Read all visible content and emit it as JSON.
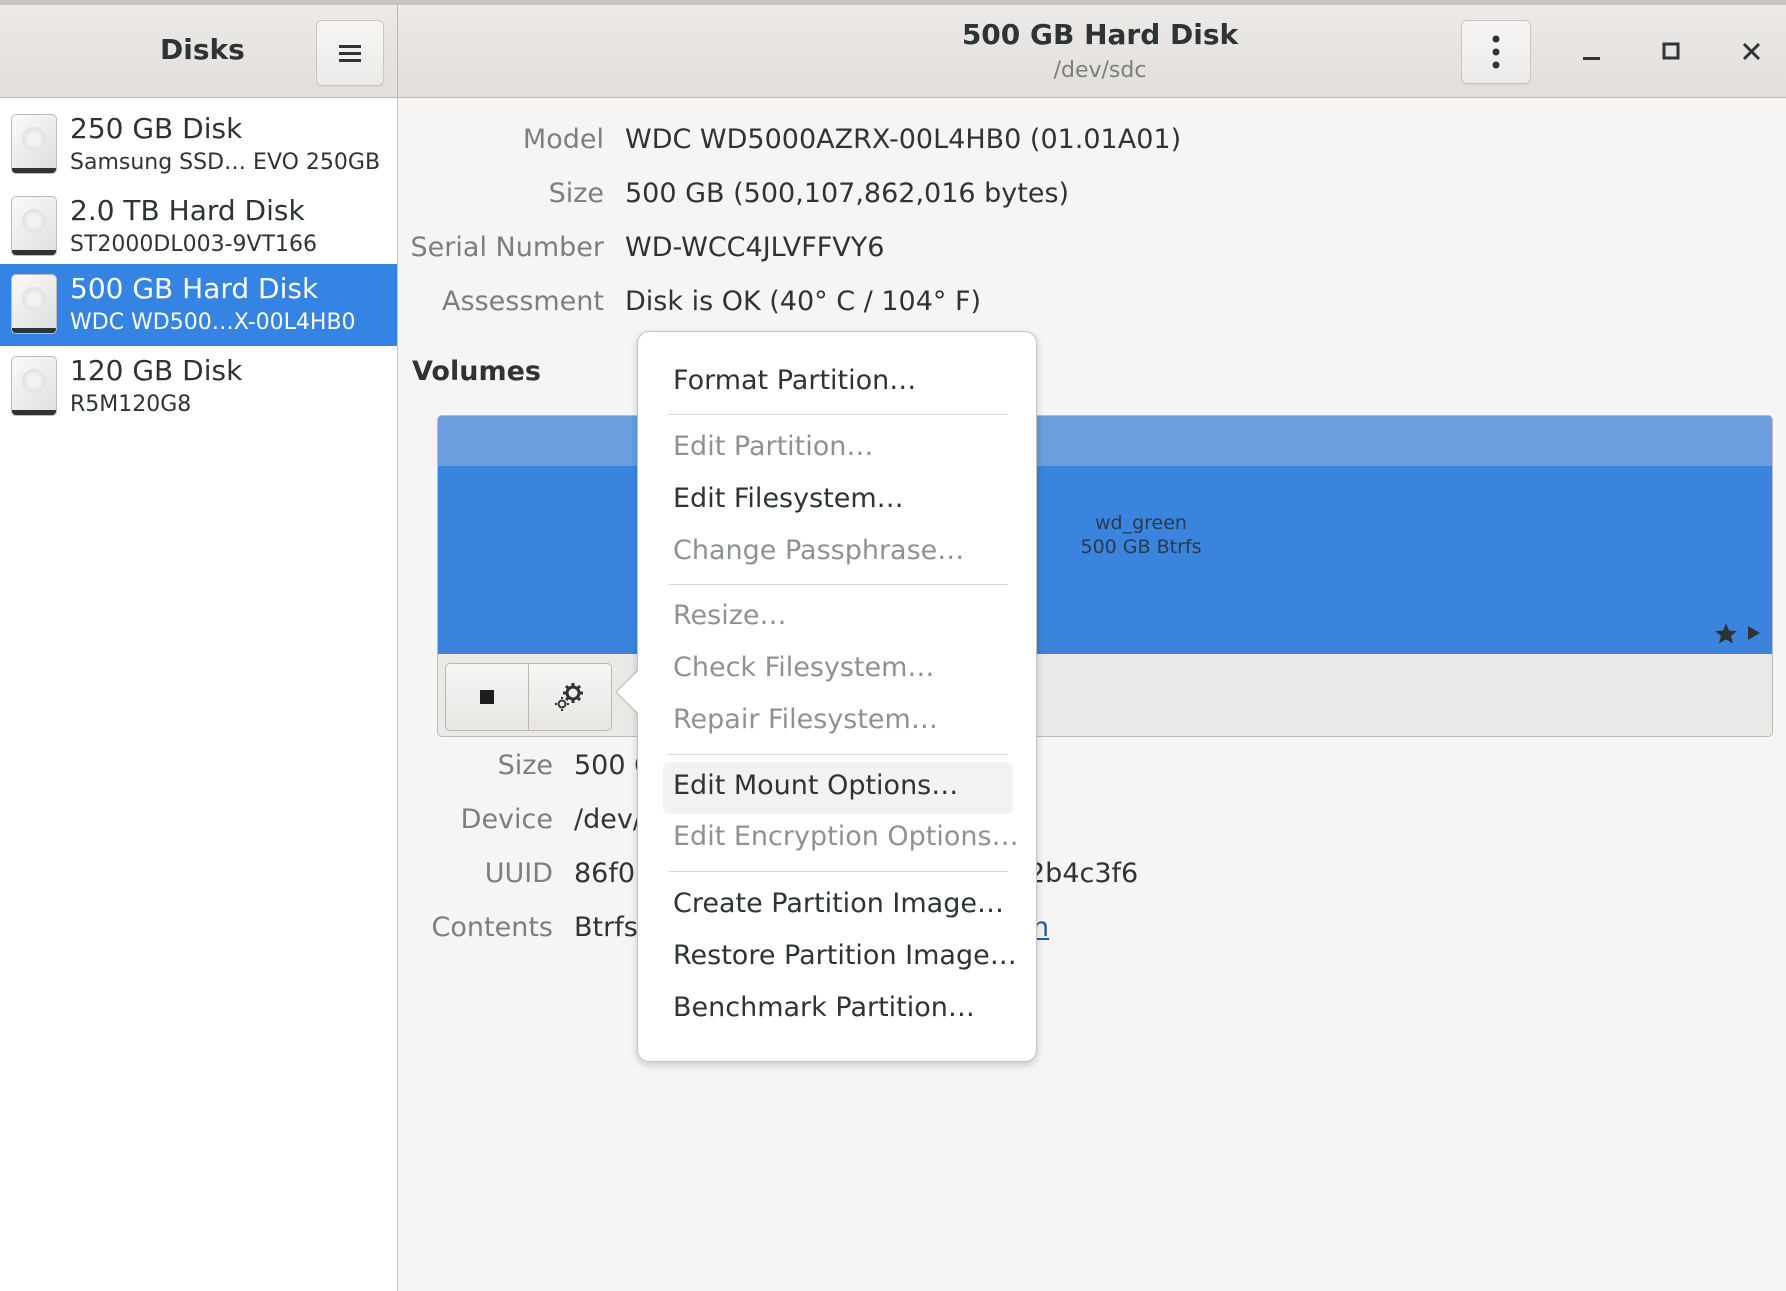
{
  "sidebar": {
    "title": "Disks",
    "menu_icon": "hamburger-menu-icon",
    "disks": [
      {
        "title": "250 GB Disk",
        "subtitle": "Samsung SSD… EVO 250GB",
        "selected": false
      },
      {
        "title": "2.0 TB Hard Disk",
        "subtitle": "ST2000DL003-9VT166",
        "selected": false
      },
      {
        "title": "500 GB Hard Disk",
        "subtitle": "WDC WD500…X-00L4HB0",
        "selected": true
      },
      {
        "title": "120 GB Disk",
        "subtitle": "R5M120G8",
        "selected": false
      }
    ]
  },
  "header": {
    "title": "500 GB Hard Disk",
    "subtitle": "/dev/sdc",
    "kebab_icon": "kebab-menu-icon",
    "controls": {
      "minimize": "minimize-icon",
      "maximize": "maximize-icon",
      "close": "close-icon"
    }
  },
  "disk_info": {
    "model_label": "Model",
    "model_value": "WDC WD5000AZRX-00L4HB0 (01.01A01)",
    "size_label": "Size",
    "size_value": "500 GB (500,107,862,016 bytes)",
    "serial_label": "Serial Number",
    "serial_value": "WD-WCC4JLVFFVY6",
    "assessment_label": "Assessment",
    "assessment_value": "Disk is OK (40° C / 104° F)"
  },
  "volumes": {
    "title": "Volumes",
    "partition_name": "wd_green",
    "partition_desc": "500 GB Btrfs",
    "colors": {
      "partition": "#3a84dd",
      "partition_top": "#6a9edf"
    }
  },
  "volume_info": {
    "size_label": "Size",
    "size_value": "500 G",
    "device_label": "Device",
    "device_value": "/dev/",
    "uuid_label": "UUID",
    "uuid_value_start": "86f0",
    "uuid_value_end": "2b4c3f6",
    "contents_label": "Contents",
    "contents_value": "Btrfs",
    "contents_link_tail": "n"
  },
  "context_menu": {
    "items": [
      {
        "label": "Format Partition…",
        "enabled": true
      },
      {
        "label": "Edit Partition…",
        "enabled": false
      },
      {
        "label": "Edit Filesystem…",
        "enabled": true
      },
      {
        "label": "Change Passphrase…",
        "enabled": false
      },
      {
        "label": "Resize…",
        "enabled": false
      },
      {
        "label": "Check Filesystem…",
        "enabled": false
      },
      {
        "label": "Repair Filesystem…",
        "enabled": false
      },
      {
        "label": "Edit Mount Options…",
        "enabled": true,
        "hovered": true
      },
      {
        "label": "Edit Encryption Options…",
        "enabled": false
      },
      {
        "label": "Create Partition Image…",
        "enabled": true
      },
      {
        "label": "Restore Partition Image…",
        "enabled": true
      },
      {
        "label": "Benchmark Partition…",
        "enabled": true
      }
    ]
  },
  "accent_color": "#3584e4"
}
